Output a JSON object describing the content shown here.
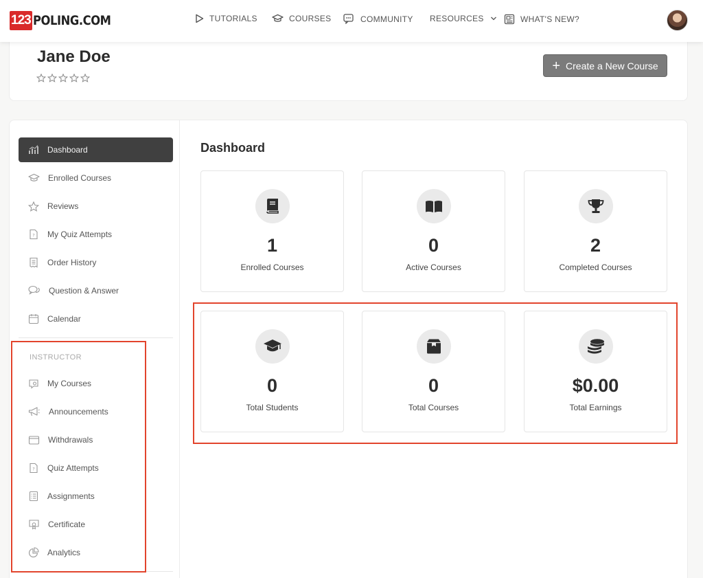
{
  "brand": {
    "number": "123",
    "text": "POLING.COM"
  },
  "nav": {
    "tutorials": "TUTORIALS",
    "courses": "COURSES",
    "community": "COMMUNITY",
    "resources": "RESOURCES",
    "whats_new": "WHAT'S NEW?"
  },
  "profile": {
    "name": "Jane Doe",
    "rating_stars": 5,
    "create_button": "Create a New Course"
  },
  "sidebar": {
    "items": [
      {
        "label": "Dashboard",
        "icon": "dashboard-icon"
      },
      {
        "label": "Enrolled Courses",
        "icon": "graduation-cap-icon"
      },
      {
        "label": "Reviews",
        "icon": "star-icon"
      },
      {
        "label": "My Quiz Attempts",
        "icon": "quiz-icon"
      },
      {
        "label": "Order History",
        "icon": "receipt-icon"
      },
      {
        "label": "Question & Answer",
        "icon": "chat-bubbles-icon"
      },
      {
        "label": "Calendar",
        "icon": "calendar-icon"
      }
    ],
    "instructor_heading": "INSTRUCTOR",
    "instructor_items": [
      {
        "label": "My Courses",
        "icon": "rocket-icon"
      },
      {
        "label": "Announcements",
        "icon": "megaphone-icon"
      },
      {
        "label": "Withdrawals",
        "icon": "wallet-icon"
      },
      {
        "label": "Quiz Attempts",
        "icon": "quiz-icon"
      },
      {
        "label": "Assignments",
        "icon": "checklist-icon"
      },
      {
        "label": "Certificate",
        "icon": "certificate-icon"
      },
      {
        "label": "Analytics",
        "icon": "pie-chart-icon"
      }
    ]
  },
  "dashboard": {
    "title": "Dashboard",
    "stats": [
      {
        "value": "1",
        "label": "Enrolled Courses",
        "icon": "book-icon"
      },
      {
        "value": "0",
        "label": "Active Courses",
        "icon": "open-book-icon"
      },
      {
        "value": "2",
        "label": "Completed Courses",
        "icon": "trophy-icon"
      },
      {
        "value": "0",
        "label": "Total Students",
        "icon": "graduation-cap-icon"
      },
      {
        "value": "0",
        "label": "Total Courses",
        "icon": "box-icon"
      },
      {
        "value": "$0.00",
        "label": "Total Earnings",
        "icon": "coins-icon"
      }
    ]
  },
  "colors": {
    "brand_red": "#d92a2a",
    "active_item": "#404040",
    "highlight": "#e2442c"
  }
}
